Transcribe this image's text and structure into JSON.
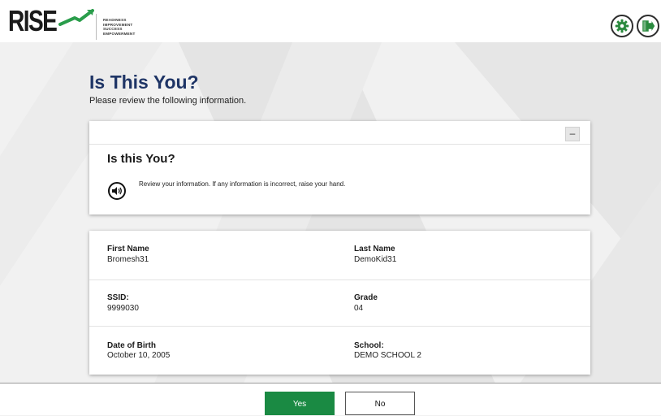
{
  "header": {
    "logo_text": "RISE",
    "logo_tagline": [
      "READINESS",
      "IMPROVEMENT",
      "SUCCESS",
      "EMPOWERMENT"
    ],
    "settings_icon": "gear-icon",
    "logout_icon": "exit-door-icon"
  },
  "page": {
    "title": "Is This You?",
    "subtitle": "Please review the following information."
  },
  "info_card": {
    "collapse_label": "–",
    "heading": "Is this You?",
    "audio_icon": "speaker-icon",
    "message": "Review your information. If any information is incorrect, raise your hand."
  },
  "student": {
    "first_name_label": "First Name",
    "first_name": "Bromesh31",
    "last_name_label": "Last Name",
    "last_name": "DemoKid31",
    "ssid_label": "SSID:",
    "ssid": "9999030",
    "grade_label": "Grade",
    "grade": "04",
    "dob_label": "Date of Birth",
    "dob": "October 10, 2005",
    "school_label": "School:",
    "school": "DEMO SCHOOL 2"
  },
  "footer": {
    "yes_label": "Yes",
    "no_label": "No"
  },
  "colors": {
    "title": "#1f3566",
    "yes_button": "#1a8a43",
    "logo_swoosh": "#2a9d4b"
  }
}
